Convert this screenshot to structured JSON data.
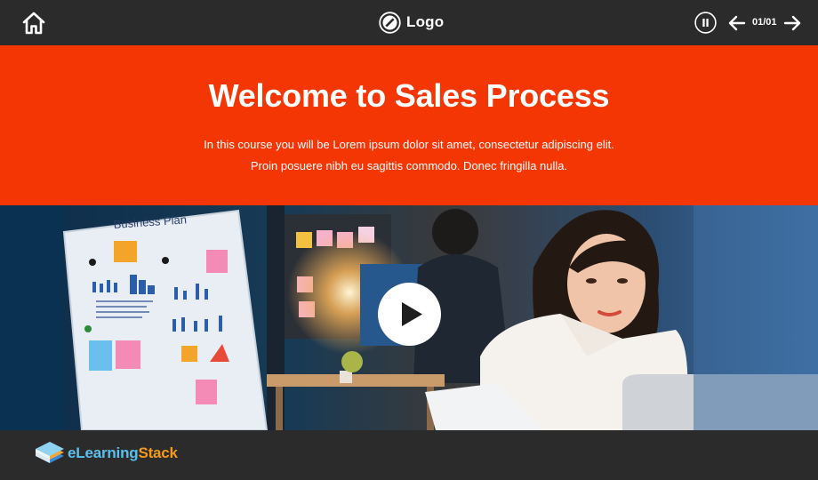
{
  "header": {
    "home_icon": "home-icon",
    "logo_icon": "slash-circle-icon",
    "logo_text": "Logo",
    "pause_icon": "pause-icon",
    "prev_icon": "arrow-left-icon",
    "next_icon": "arrow-right-icon",
    "page_counter": "01/01"
  },
  "hero": {
    "title": "Welcome to Sales Process",
    "description_line1": "In this course you will be Lorem ipsum dolor sit amet, consectetur adipiscing elit.",
    "description_line2": "Proin posuere nibh eu sagittis commodo. Donec fringilla nulla.",
    "background_color": "#f43605"
  },
  "media": {
    "whiteboard_text": "Business Plan",
    "play_icon": "play-icon"
  },
  "footer": {
    "brand_part1": "eLearning",
    "brand_part2": "Stack",
    "brand_color1": "#5bc0ee",
    "brand_color2": "#f39a1e"
  }
}
